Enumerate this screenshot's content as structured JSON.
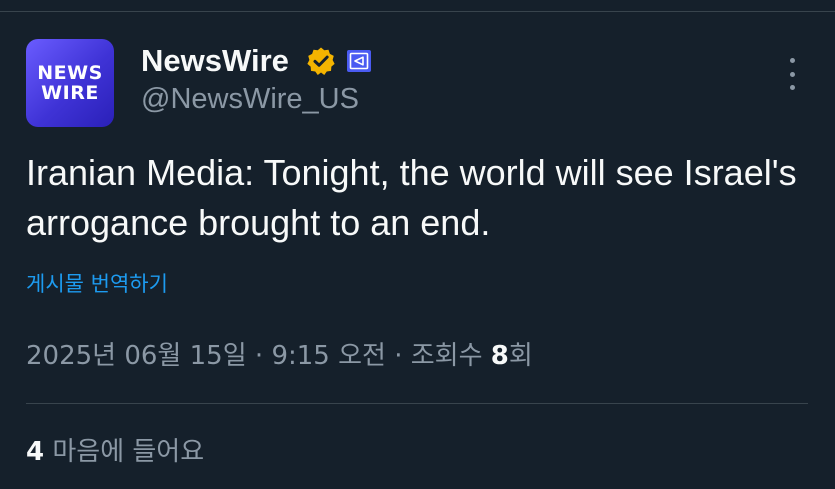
{
  "author": {
    "avatar_text": [
      "NEWS",
      "WIRE"
    ],
    "display_name": "NewsWire",
    "handle": "@NewsWire_US",
    "verified_icon": "verified-badge-gold-icon",
    "affiliate_icon": "affiliate-badge-icon"
  },
  "tweet": {
    "text": "Iranian Media: Tonight, the world will see Israel's arrogance brought to an end.",
    "translate_label": "게시물 번역하기"
  },
  "meta": {
    "date": "2025년 06월 15일",
    "separator": " · ",
    "time": "9:15 오전",
    "views_label": "조회수",
    "views_count": "8",
    "views_suffix": "회"
  },
  "engagement": {
    "likes_count": "4",
    "likes_label": "마음에 들어요"
  },
  "colors": {
    "background": "#15202b",
    "text_primary": "#f7f9f9",
    "text_secondary": "#8b98a5",
    "link": "#1d9bf0",
    "verified": "#f4b400",
    "divider": "#38444d"
  }
}
